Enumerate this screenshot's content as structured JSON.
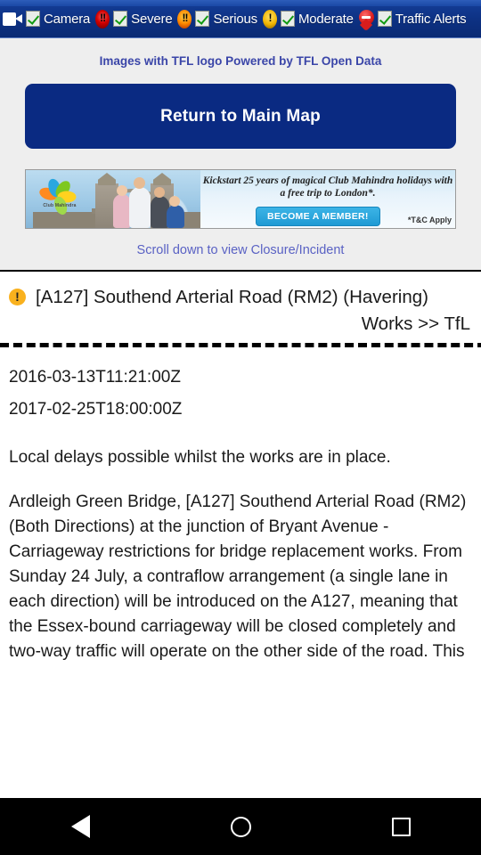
{
  "topbar": {
    "filters": [
      {
        "icon": "camcorder-icon",
        "label": "Camera",
        "checked": true
      },
      {
        "icon": "severe-alert-icon",
        "label": "Severe",
        "checked": true,
        "glyph": "!!"
      },
      {
        "icon": "serious-alert-icon",
        "label": "Serious",
        "checked": true,
        "glyph": "!!"
      },
      {
        "icon": "moderate-alert-icon",
        "label": "Moderate",
        "checked": true,
        "glyph": "!"
      },
      {
        "icon": "map-pin-icon",
        "label": "Traffic Alerts",
        "checked": true
      }
    ]
  },
  "header": {
    "tfl_note": "Images with TFL logo Powered by TFL Open Data",
    "return_button": "Return to Main Map",
    "scroll_note": "Scroll down to view Closure/Incident"
  },
  "ad": {
    "logo_text": "Club Mahindra",
    "copy": "Kickstart 25 years of magical Club Mahindra holidays with a free trip to London*.",
    "cta": "BECOME A MEMBER!",
    "terms": "*T&C Apply"
  },
  "incident": {
    "severity_icon": "warning-icon",
    "title": "[A127] Southend Arterial Road (RM2) (Havering)",
    "category": "Works >> TfL",
    "start_time": "2016-03-13T11:21:00Z",
    "end_time": "2017-02-25T18:00:00Z",
    "summary": "Local delays possible whilst the works are in place.",
    "description": "Ardleigh Green Bridge, [A127] Southend Arterial Road (RM2) (Both Directions) at the junction of Bryant Avenue - Carriageway restrictions for bridge replacement works. From Sunday 24 July, a contraflow arrangement (a single lane in each direction) will be introduced on the A127, meaning that the Essex-bound carriageway will be closed completely and two-way traffic will operate on the other side of the road. This"
  },
  "navbar": {
    "back": "back-button",
    "home": "home-button",
    "recents": "recents-button"
  },
  "colors": {
    "topbar_blue": "#0d3182",
    "button_navy": "#0a2a82",
    "link_blue": "#3a45a8",
    "scroll_note_blue": "#5a62c4",
    "warning_amber": "#f9b11e",
    "panel_gray": "#eeeeee"
  }
}
